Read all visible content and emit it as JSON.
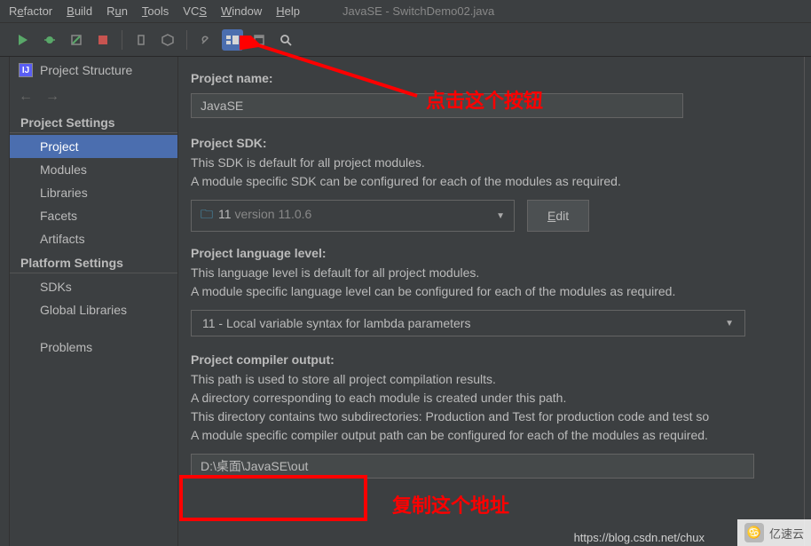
{
  "colors": {
    "accent": "#4b6eaf",
    "bg": "#3c3f41",
    "text": "#bbbbbb",
    "annotation": "#ff0000"
  },
  "menubar": {
    "items": [
      {
        "pre": "R",
        "u": "e",
        "post": "factor"
      },
      {
        "pre": "",
        "u": "B",
        "post": "uild"
      },
      {
        "pre": "R",
        "u": "u",
        "post": "n"
      },
      {
        "pre": "",
        "u": "T",
        "post": "ools"
      },
      {
        "pre": "VC",
        "u": "S",
        "post": ""
      },
      {
        "pre": "",
        "u": "W",
        "post": "indow"
      },
      {
        "pre": "",
        "u": "H",
        "post": "elp"
      }
    ],
    "title": "JavaSE - SwitchDemo02.java"
  },
  "toolbar": {
    "icons": [
      "play-icon",
      "bug-icon",
      "coverage-icon",
      "stop-icon",
      "attach-icon",
      "package-icon",
      "wrench-icon",
      "structure-icon",
      "new-window-icon",
      "search-icon"
    ]
  },
  "sidebar": {
    "header_icon": "IJ",
    "header_title": "Project Structure",
    "sections": [
      {
        "label": "Project Settings",
        "items": [
          {
            "label": "Project",
            "active": true
          },
          {
            "label": "Modules",
            "active": false
          },
          {
            "label": "Libraries",
            "active": false
          },
          {
            "label": "Facets",
            "active": false
          },
          {
            "label": "Artifacts",
            "active": false
          }
        ]
      },
      {
        "label": "Platform Settings",
        "items": [
          {
            "label": "SDKs",
            "active": false
          },
          {
            "label": "Global Libraries",
            "active": false
          }
        ]
      }
    ],
    "problems": "Problems"
  },
  "content": {
    "project_name_label": "Project name:",
    "project_name_value": "JavaSE",
    "sdk_label": "Project SDK:",
    "sdk_desc1": "This SDK is default for all project modules.",
    "sdk_desc2": "A module specific SDK can be configured for each of the modules as required.",
    "sdk_value_name": "11",
    "sdk_value_version": "version 11.0.6",
    "edit_label": "Edit",
    "lang_label": "Project language level:",
    "lang_desc1": "This language level is default for all project modules.",
    "lang_desc2": "A module specific language level can be configured for each of the modules as required.",
    "lang_value": "11 - Local variable syntax for lambda parameters",
    "output_label": "Project compiler output:",
    "output_desc1": "This path is used to store all project compilation results.",
    "output_desc2": "A directory corresponding to each module is created under this path.",
    "output_desc3": "This directory contains two subdirectories: Production and Test for production code and test so",
    "output_desc4": "A module specific compiler output path can be configured for each of the modules as required.",
    "output_value": "D:\\桌面\\JavaSE\\out"
  },
  "annotations": {
    "top": "点击这个按钮",
    "bottom": "复制这个地址"
  },
  "watermark": {
    "icon": "♋",
    "text": "亿速云"
  },
  "footer_url": "https://blog.csdn.net/chux"
}
